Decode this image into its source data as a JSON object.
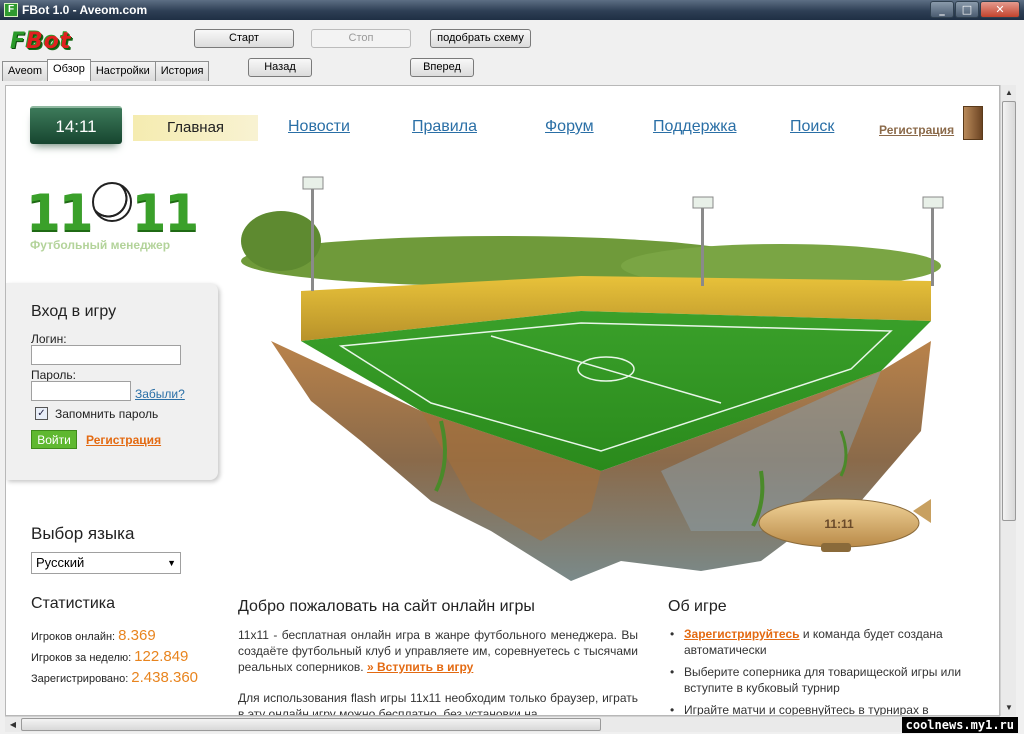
{
  "window": {
    "title": "FBot 1.0 - Aveom.com",
    "icon": "F",
    "controls": [
      "_",
      "□",
      "✕"
    ]
  },
  "toolbar": {
    "logo": "FBot",
    "start": "Старт",
    "stop": "Стоп",
    "scheme": "подобрать схему",
    "back": "Назад",
    "forward": "Вперед"
  },
  "tabs": [
    "Aveom",
    "Обзор",
    "Настройки",
    "История"
  ],
  "site": {
    "clock": "14:11",
    "nav": {
      "home": "Главная",
      "news": "Новости",
      "rules": "Правила",
      "forum": "Форум",
      "support": "Поддержка",
      "search": "Поиск",
      "register": "Регистрация"
    },
    "brand": {
      "left": "11",
      "right": "11",
      "subtitle": "Футбольный менеджер"
    },
    "login": {
      "title": "Вход в игру",
      "login_label": "Логин:",
      "password_label": "Пароль:",
      "forgot": "Забыли?",
      "remember": "Запомнить пароль",
      "submit": "Войти",
      "register": "Регистрация"
    },
    "language": {
      "title": "Выбор языка",
      "selected": "Русский"
    },
    "stats": {
      "title": "Статистика",
      "online_label": "Игроков онлайн:",
      "online": "8.369",
      "week_label": "Игроков за неделю:",
      "week": "122.849",
      "registered_label": "Зарегистрировано:",
      "registered": "2.438.360"
    },
    "welcome": {
      "title": "Добро пожаловать на сайт онлайн игры",
      "p1": "11x11 - бесплатная онлайн игра в жанре футбольного менеджера. Вы создаёте футбольный клуб и управляете им, соревнуетесь с тысячами реальных соперников.",
      "p1_link": "» Вступить в игру",
      "p2": "Для использования flash игры 11x11 необходим только браузер, играть в эту онлайн игру можно бесплатно, без установки на"
    },
    "about": {
      "title": "Об игре",
      "item1_link": "Зарегистрируйтесь",
      "item1_text": " и команда будет создана автоматически",
      "item2": "Выберите соперника для товарищеской игры или вступите в кубковый турнир",
      "item3": "Играйте матчи и соревнуйтесь в турнирах в"
    },
    "airship_text": "11:11"
  },
  "watermark": "coolnews.my1.ru",
  "colors": {
    "accent_green": "#3aa02a",
    "link_blue": "#2a6fa6",
    "link_orange": "#e36a12",
    "stat_orange": "#e8841e"
  }
}
